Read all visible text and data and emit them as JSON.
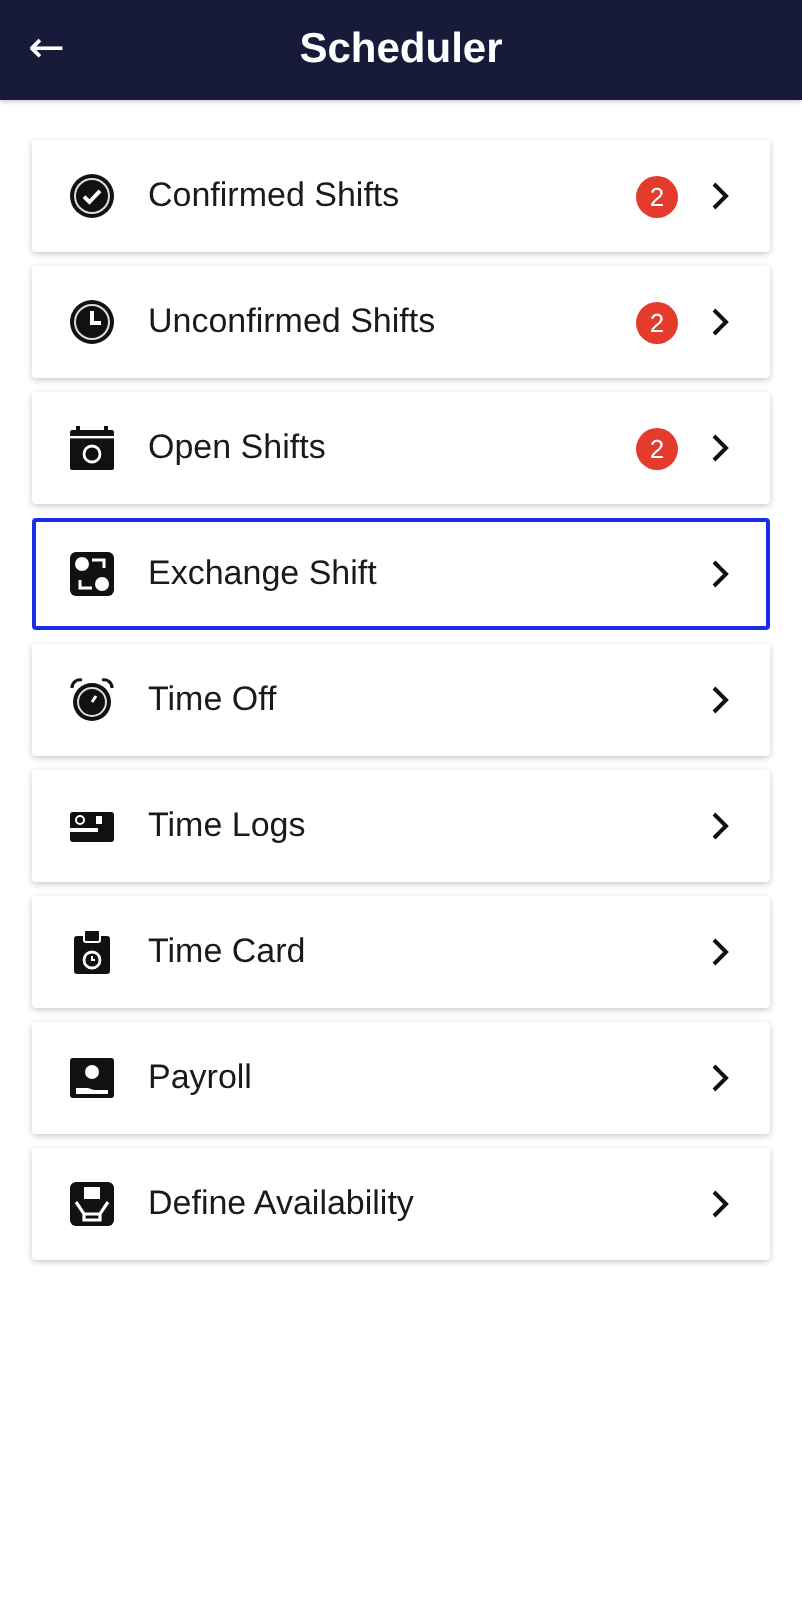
{
  "header": {
    "back": "←",
    "title": "Scheduler"
  },
  "items": [
    {
      "kind": "confirmed",
      "label": "Confirmed Shifts",
      "badge": "2",
      "selected": false
    },
    {
      "kind": "unconfirmed",
      "label": "Unconfirmed Shifts",
      "badge": "2",
      "selected": false
    },
    {
      "kind": "open",
      "label": "Open Shifts",
      "badge": "2",
      "selected": false
    },
    {
      "kind": "exchange",
      "label": "Exchange Shift",
      "selected": true
    },
    {
      "kind": "timeoff",
      "label": "Time Off",
      "selected": false
    },
    {
      "kind": "timelogs",
      "label": "Time Logs",
      "selected": false
    },
    {
      "kind": "timecard",
      "label": "Time Card",
      "selected": false
    },
    {
      "kind": "payroll",
      "label": "Payroll",
      "selected": false
    },
    {
      "kind": "availability",
      "label": "Define Availability",
      "selected": false
    }
  ]
}
